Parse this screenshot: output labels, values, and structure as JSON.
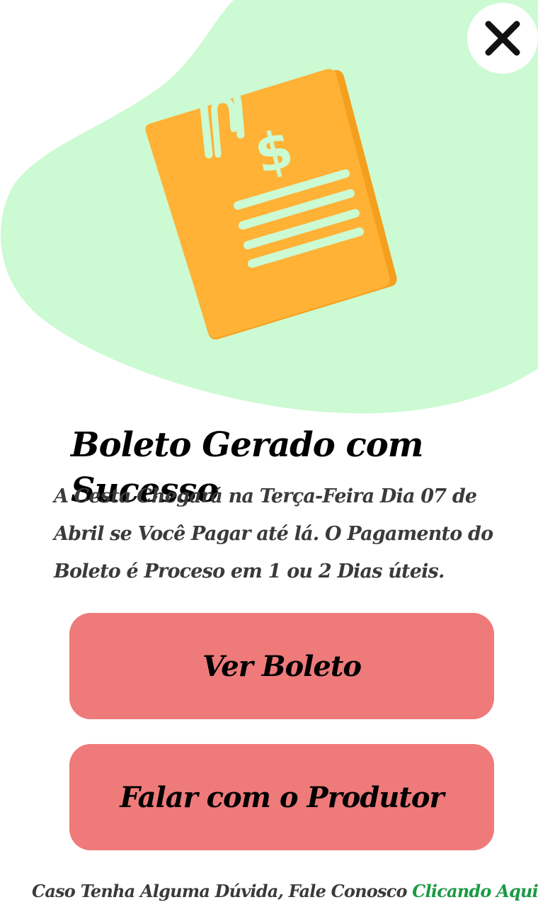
{
  "header": {
    "close_icon": "close-icon",
    "illustration_icon": "invoice-document-icon"
  },
  "content": {
    "title": "Boleto Gerado com Sucesso",
    "description": "A Cesta Chegará na Terça-Feira Dia 07 de Abril se Você Pagar até lá. O Pagamento do Boleto é Proceso em 1 ou 2 Dias úteis."
  },
  "actions": {
    "view_boleto_label": "Ver Boleto",
    "talk_producer_label": "Falar com o Produtor"
  },
  "footer": {
    "text": "Caso Tenha Alguma Dúvida, Fale Conosco ",
    "link_label": "Clicando Aqui"
  },
  "colors": {
    "blob": "#ccfad2",
    "button": "#ef7a7a",
    "link": "#1a9a45",
    "document": "#ffb236",
    "document_back": "#5cb04a"
  }
}
